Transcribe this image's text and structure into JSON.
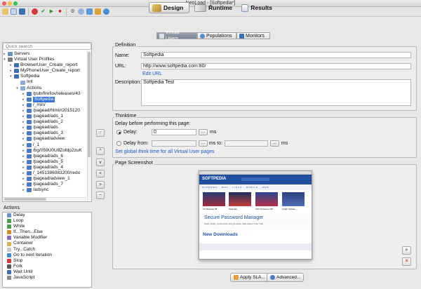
{
  "window": {
    "title": "NeoLoad - [Softpedia*]"
  },
  "modes": [
    {
      "label": "Design",
      "active": true
    },
    {
      "label": "Runtime",
      "active": false
    },
    {
      "label": "Results",
      "active": false
    }
  ],
  "subtabs": [
    {
      "label": "Virtual Users",
      "active": true
    },
    {
      "label": "Populations",
      "active": false
    },
    {
      "label": "Monitors",
      "active": false
    }
  ],
  "left": {
    "search_placeholder": "Quick search",
    "tree": [
      {
        "label": "Servers",
        "depth": 0,
        "twisty": "▸",
        "color": "#6a8fb8"
      },
      {
        "label": "Virtual User Profiles",
        "depth": 0,
        "twisty": "▾",
        "color": "#7a7a7a"
      },
      {
        "label": "BrowserUser_Create_report",
        "depth": 1,
        "twisty": "▸",
        "color": "#3d6fb5"
      },
      {
        "label": "MyPhoneUser_Create_report",
        "depth": 1,
        "twisty": "▸",
        "color": "#3d6fb5"
      },
      {
        "label": "Softpedia",
        "depth": 1,
        "twisty": "▾",
        "color": "#3d6fb5"
      },
      {
        "label": "Init",
        "depth": 2,
        "twisty": "",
        "color": "#8aa9d4"
      },
      {
        "label": "Actions",
        "depth": 2,
        "twisty": "▾",
        "color": "#8aa9d4"
      },
      {
        "label": "/pub/firefox/releases/43",
        "depth": 3,
        "twisty": "▸",
        "color": "#4b7cc2"
      },
      {
        "label": "Softpedia",
        "depth": 3,
        "twisty": "▸",
        "color": "#4b7cc2",
        "selected": true
      },
      {
        "label": "/_min/",
        "depth": 3,
        "twisty": "▸",
        "color": "#4b7cc2"
      },
      {
        "label": "/pagead/html/r2015120",
        "depth": 3,
        "twisty": "▸",
        "color": "#4b7cc2"
      },
      {
        "label": "/pagead/ads_1",
        "depth": 3,
        "twisty": "▸",
        "color": "#4b7cc2"
      },
      {
        "label": "/pagead/ads_2",
        "depth": 3,
        "twisty": "▸",
        "color": "#4b7cc2"
      },
      {
        "label": "/pagead/ads",
        "depth": 3,
        "twisty": "▸",
        "color": "#4b7cc2"
      },
      {
        "label": "/pagead/ads_3",
        "depth": 3,
        "twisty": "▸",
        "color": "#4b7cc2"
      },
      {
        "label": "/pagead/adview",
        "depth": 3,
        "twisty": "▸",
        "color": "#4b7cc2"
      },
      {
        "label": "/_1",
        "depth": 3,
        "twisty": "▸",
        "color": "#4b7cc2"
      },
      {
        "label": "/bg/059U0U8Zofdp2zuK",
        "depth": 3,
        "twisty": "▸",
        "color": "#4b7cc2"
      },
      {
        "label": "/pagead/ads_6",
        "depth": 3,
        "twisty": "▸",
        "color": "#4b7cc2"
      },
      {
        "label": "/pagead/ads_5",
        "depth": 3,
        "twisty": "▸",
        "color": "#4b7cc2"
      },
      {
        "label": "/pagead/ads_4",
        "depth": 3,
        "twisty": "▸",
        "color": "#4b7cc2"
      },
      {
        "label": "/_1451386083200/redo",
        "depth": 3,
        "twisty": "▸",
        "color": "#4b7cc2"
      },
      {
        "label": "/pagead/adview_1",
        "depth": 3,
        "twisty": "▸",
        "color": "#4b7cc2"
      },
      {
        "label": "/pagead/ads_7",
        "depth": 3,
        "twisty": "▸",
        "color": "#4b7cc2"
      },
      {
        "label": "/adsync",
        "depth": 3,
        "twisty": "▸",
        "color": "#4b7cc2"
      }
    ],
    "actions_title": "Actions",
    "actions": [
      {
        "label": "Delay",
        "color": "#6b8fc4"
      },
      {
        "label": "Loop",
        "color": "#4a9a4a"
      },
      {
        "label": "While",
        "color": "#4a9a4a"
      },
      {
        "label": "If...Then...Else",
        "color": "#d08a2a"
      },
      {
        "label": "Variable Modifier",
        "color": "#8a6bb8"
      },
      {
        "label": "Container",
        "color": "#d4b44a"
      },
      {
        "label": "Try...Catch",
        "color": "#c9c9c9"
      },
      {
        "label": "Go to next iteration",
        "color": "#3d8ad0"
      },
      {
        "label": "Stop",
        "color": "#d03a3a"
      },
      {
        "label": "Fork",
        "color": "#5a5a5a"
      },
      {
        "label": "Wait Until",
        "color": "#3d6fb5"
      },
      {
        "label": "JavaScript",
        "color": "#8a8a8a"
      }
    ]
  },
  "middle_buttons": [
    "+",
    "−",
    "^",
    "v",
    "<",
    ">",
    "−"
  ],
  "definition": {
    "title": "Definition",
    "name_label": "Name:",
    "name_value": "Softpedia",
    "url_label": "URL:",
    "url_value": "http://www.softpedia.com:80/",
    "edit_url": "Edit URL",
    "desc_label": "Description:",
    "desc_value": "Softpedia Test"
  },
  "thinktime": {
    "title": "Thinktime",
    "before_label": "Delay before performing this page:",
    "delay_label": "Delay:",
    "delay_value": "0",
    "ellipsis": "...",
    "ms": "ms",
    "delay_from_label": "Delay from:",
    "ms_to": "ms to:",
    "global_link": "Set global think time for all Virtual User pages"
  },
  "screenshot": {
    "title": "Page Screenshot",
    "logo": "SOFTPEDIA",
    "banner": "Secure Password Manager",
    "banner_sub": "Store, share, synchronize and generate. Web-based. Free Trial",
    "section": "New Downloads",
    "nav_items": [
      "WINDOWS",
      "MAC",
      "LINUX",
      "MOBILE",
      "WEB"
    ],
    "cards": [
      "Lili Webcast 08",
      "Total Sky",
      "VHX Protection 88",
      "Smart Update"
    ]
  },
  "bottom": {
    "apply_sla": "Apply SLA...",
    "advanced": "Advanced..."
  },
  "colors": {
    "selection": "#3875d7",
    "link": "#1d57c9",
    "softpedia_blue": "#1f4f9e"
  }
}
